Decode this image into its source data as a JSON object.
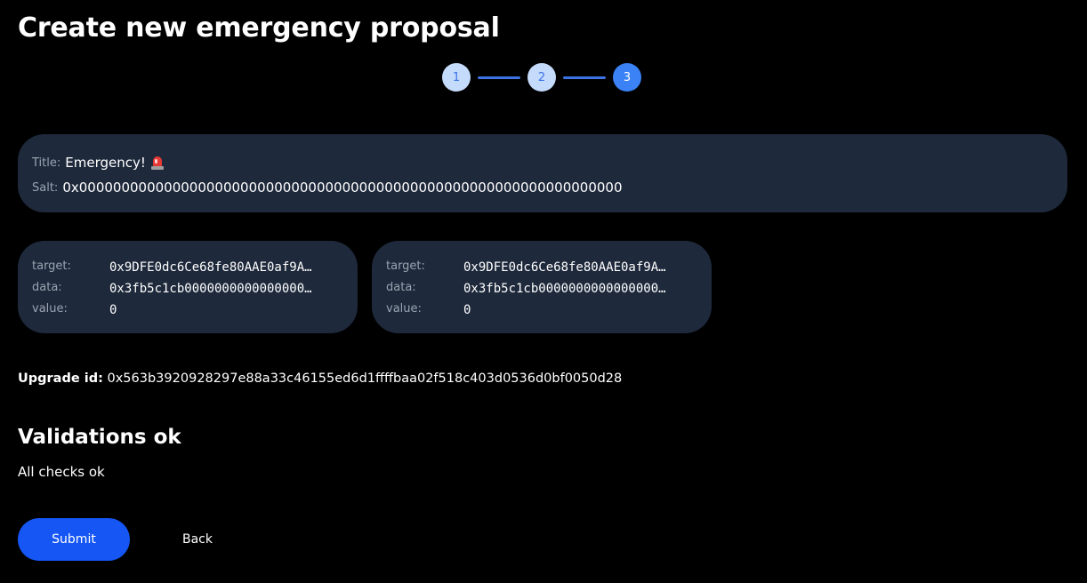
{
  "page": {
    "title": "Create new emergency proposal"
  },
  "stepper": {
    "steps": [
      "1",
      "2",
      "3"
    ],
    "current_step": 3,
    "colors": {
      "done_bg": "#c5dbfb",
      "active_bg": "#3b82f6",
      "line": "#3b74e6"
    }
  },
  "summary": {
    "title_label": "Title:",
    "title_value": "Emergency!",
    "title_emoji_icon": "police-siren-icon",
    "salt_label": "Salt:",
    "salt_value": "0x0000000000000000000000000000000000000000000000000000000000000000"
  },
  "calls": [
    {
      "target_label": "target:",
      "target_value": "0x9DFE0dc6Ce68fe80AAE0af9A…",
      "data_label": "data:",
      "data_value": "0x3fb5c1cb0000000000000000…",
      "value_label": "value:",
      "value_value": "0"
    },
    {
      "target_label": "target:",
      "target_value": "0x9DFE0dc6Ce68fe80AAE0af9A…",
      "data_label": "data:",
      "data_value": "0x3fb5c1cb0000000000000000…",
      "value_label": "value:",
      "value_value": "0"
    }
  ],
  "upgrade": {
    "label": "Upgrade id:",
    "value": "0x563b3920928297e88a33c46155ed6d1ffffbaa02f518c403d0536d0bf0050d28"
  },
  "validations": {
    "title": "Validations ok",
    "message": "All checks ok"
  },
  "actions": {
    "submit_label": "Submit",
    "back_label": "Back",
    "submit_color": "#1556f5"
  },
  "theme": {
    "background": "#000000",
    "card_background": "#1e293b"
  }
}
